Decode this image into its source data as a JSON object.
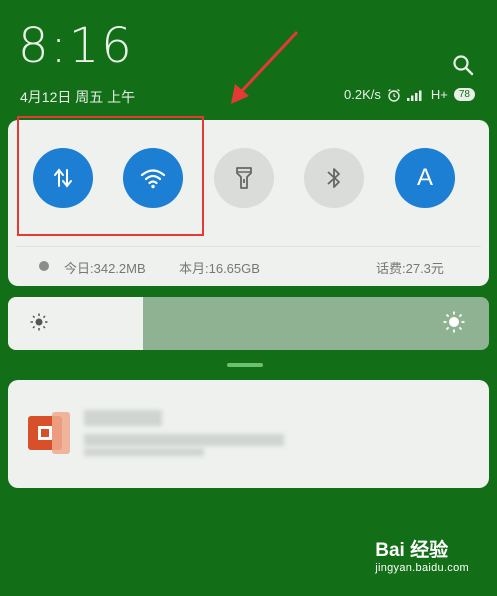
{
  "status_bar": {
    "time": "8:16",
    "date": "4月12日 周五 上午",
    "network_speed": "0.2K/s",
    "network_type": "H+",
    "battery": "78",
    "icons": [
      "search-icon",
      "alarm-icon",
      "signal-icon",
      "battery-icon"
    ]
  },
  "quick_toggles": [
    {
      "name": "mobile-data",
      "icon": "data-arrows-icon",
      "state": "on"
    },
    {
      "name": "wifi",
      "icon": "wifi-icon",
      "state": "on"
    },
    {
      "name": "flashlight",
      "icon": "flashlight-icon",
      "state": "off"
    },
    {
      "name": "bluetooth",
      "icon": "bluetooth-icon",
      "state": "off"
    },
    {
      "name": "auto-brightness",
      "icon": "letter-a",
      "label": "A",
      "state": "on"
    }
  ],
  "usage": {
    "today": "今日:342.2MB",
    "month": "本月:16.65GB",
    "balance": "话费:27.3元"
  },
  "brightness": {
    "level": 0.28
  },
  "notification": {
    "app_icon": "office-app-icon",
    "content_blurred": true
  },
  "watermark": {
    "logo": "Bai 经验",
    "url": "jingyan.baidu.com"
  },
  "colors": {
    "background": "#136f17",
    "toggle_on": "#1d7fd3",
    "toggle_off": "#d9dcd9",
    "annotation": "#e53935"
  }
}
